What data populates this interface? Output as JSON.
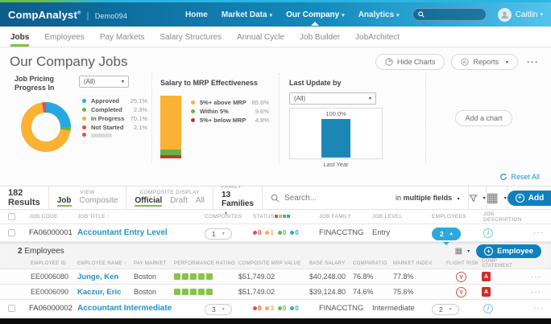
{
  "colors": {
    "accent_green": "#7dc242",
    "link_blue": "#2492c8",
    "button_blue": "#1080bd",
    "employees_pill_blue": "#2ea7dc",
    "status": [
      "#d9534f",
      "#f0ad4e",
      "#5cb85c",
      "#29a8df"
    ]
  },
  "header": {
    "brand": "CompAnalyst",
    "brand_mark": "®",
    "env": "Demo094",
    "nav": [
      {
        "label": "Home"
      },
      {
        "label": "Market Data"
      },
      {
        "label": "Our Company"
      },
      {
        "label": "Analytics"
      }
    ],
    "search_value": "",
    "user": "Caitlin"
  },
  "tabs": {
    "items": [
      "Jobs",
      "Employees",
      "Pay Markets",
      "Salary Structures",
      "Annual Cycle",
      "Job Builder",
      "JobArchitect"
    ],
    "active": "Jobs"
  },
  "page": {
    "title": "Our Company Jobs",
    "hide_charts": "Hide Charts",
    "reports": "Reports",
    "more": "···",
    "add_chart": "Add a chart",
    "reset_all": "Reset All"
  },
  "chart_data": [
    {
      "type": "pie",
      "donut": true,
      "title": "Job Pricing Progress In",
      "filter_value": "(All)",
      "legend_position": "right",
      "categories": [
        "Approved",
        "Completed",
        "In Progress",
        "Not Started"
      ],
      "values": [
        25.1,
        2.3,
        70.1,
        2.1
      ],
      "labels": [
        "25.1%",
        "2.3%",
        "70.1%",
        "2.1%"
      ],
      "colors": [
        "#29a8df",
        "#67b346",
        "#f9b234",
        "#d9534f"
      ],
      "extra_legend_color": "#d9534f"
    },
    {
      "type": "bar",
      "subtype": "stacked-column",
      "title": "Salary to MRP Effectiveness",
      "legend_position": "right",
      "categories": [
        "5%+ above MRP",
        "Within 5%",
        "5%+ below MRP"
      ],
      "values": [
        85.6,
        9.6,
        4.8
      ],
      "labels": [
        "85.6%",
        "9.6%",
        "4.8%"
      ],
      "colors": [
        "#f9b234",
        "#67b346",
        "#c0392b"
      ]
    },
    {
      "type": "bar",
      "title": "Last Update by",
      "filter_value": "(All)",
      "categories": [
        "Last Year"
      ],
      "values": [
        100.0
      ],
      "labels": [
        "100.0%"
      ],
      "colors": [
        "#1c87b5"
      ],
      "ylim": [
        0,
        100
      ]
    }
  ],
  "toolbar": {
    "results": "182 Results",
    "view_label": "VIEW",
    "view_options": [
      "Job",
      "Composite"
    ],
    "view_active": "Job",
    "display_label": "COMPOSITE DISPLAY",
    "display_options": [
      "Official",
      "Draft",
      "All"
    ],
    "display_active": "Official",
    "family_label": "JOB FAMILY",
    "family_value": "13 Families",
    "search_placeholder": "Search...",
    "search_scope": "in multiple fields",
    "add_label": "Add"
  },
  "jobs_table": {
    "headers": {
      "code": "JOB CODE",
      "title": "JOB TITLE",
      "composites": "COMPOSITES",
      "status": "STATUS",
      "family": "JOB FAMILY",
      "level": "JOB LEVEL",
      "employees": "EMPLOYEES",
      "description": "JOB DESCRIPTION"
    },
    "rows": [
      {
        "code": "FA06000001",
        "title": "Accountant Entry Level",
        "composites": "1",
        "status": [
          "0",
          "1",
          "0",
          "0"
        ],
        "family": "FINACCTNG",
        "level": "Entry",
        "employees": "2",
        "expanded": true
      },
      {
        "code": "FA06000002",
        "title": "Accountant Intermediate",
        "composites": "3",
        "status": [
          "0",
          "3",
          "0",
          "0"
        ],
        "family": "FINACCTNG",
        "level": "Intermediate",
        "employees": "2",
        "expanded": false
      }
    ]
  },
  "employees_panel": {
    "title_count": "2",
    "title_word": "Employees",
    "add_label": "Employee",
    "headers": {
      "id": "EMPLOYEE ID",
      "name": "EMPLOYEE NAME",
      "market": "PAY MARKET",
      "rating": "PERFORMANCE RATING",
      "mrp": "COMPOSITE MRP VALUE",
      "base": "BASE SALARY",
      "ratio": "COMPARATIO",
      "index": "MARKET INDEX",
      "flight": "FLIGHT RISK",
      "statement": "COMP STATEMENT"
    },
    "rows": [
      {
        "id": "EE0006080",
        "name": "Junge, Ken",
        "market": "Boston",
        "rating": 5,
        "mrp": "$51,749.02",
        "base": "$40,248.00",
        "ratio": "76.8%",
        "index": "77.8%",
        "flight": "Y"
      },
      {
        "id": "EE0006090",
        "name": "Kaczur, Eric",
        "market": "Boston",
        "rating": 5,
        "mrp": "$51,749.02",
        "base": "$39,124.80",
        "ratio": "74.6%",
        "index": "75.6%",
        "flight": "Y"
      }
    ]
  }
}
